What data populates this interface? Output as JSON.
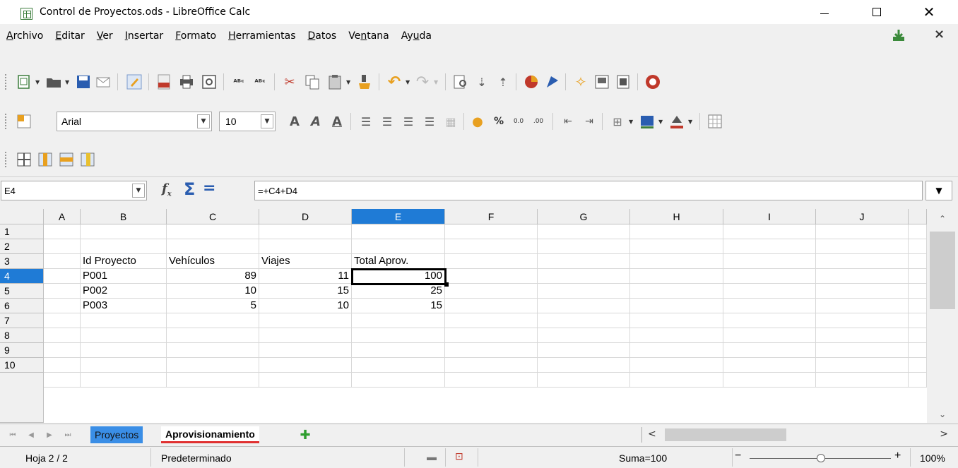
{
  "window": {
    "title": "Control de Proyectos.ods - LibreOffice Calc"
  },
  "menu": {
    "items": [
      "Archivo",
      "Editar",
      "Ver",
      "Insertar",
      "Formato",
      "Herramientas",
      "Datos",
      "Ventana",
      "Ayuda"
    ],
    "underline": [
      "A",
      "E",
      "V",
      "I",
      "F",
      "H",
      "D",
      "n",
      "u"
    ]
  },
  "toolbar_font": {
    "font_name": "Arial",
    "font_size": "10"
  },
  "formula_bar": {
    "cell_ref": "E4",
    "formula": "=+C4+D4"
  },
  "grid": {
    "columns": [
      "A",
      "B",
      "C",
      "D",
      "E",
      "F",
      "G",
      "H",
      "I",
      "J"
    ],
    "rows": [
      "1",
      "2",
      "3",
      "4",
      "5",
      "6",
      "7",
      "8",
      "9",
      "10"
    ],
    "selected_column": "E",
    "selected_row": "4",
    "header": [
      "Id Proyecto",
      "Vehículos",
      "Viajes",
      "Total Aprov."
    ],
    "data": [
      [
        "P001",
        "89",
        "11",
        "100"
      ],
      [
        "P002",
        "10",
        "15",
        "25"
      ],
      [
        "P003",
        "5",
        "10",
        "15"
      ]
    ]
  },
  "sheets": {
    "tabs": [
      "Proyectos",
      "Aprovisionamiento"
    ],
    "active": "Aprovisionamiento"
  },
  "status": {
    "sheet_info": "Hoja 2 / 2",
    "page_style": "Predeterminado",
    "sum": "Suma=100",
    "zoom": "100%"
  },
  "colors": {
    "selection": "#1f7bd6",
    "active_tab_underline": "#e03030",
    "inactive_tab": "#3a8ee6"
  }
}
